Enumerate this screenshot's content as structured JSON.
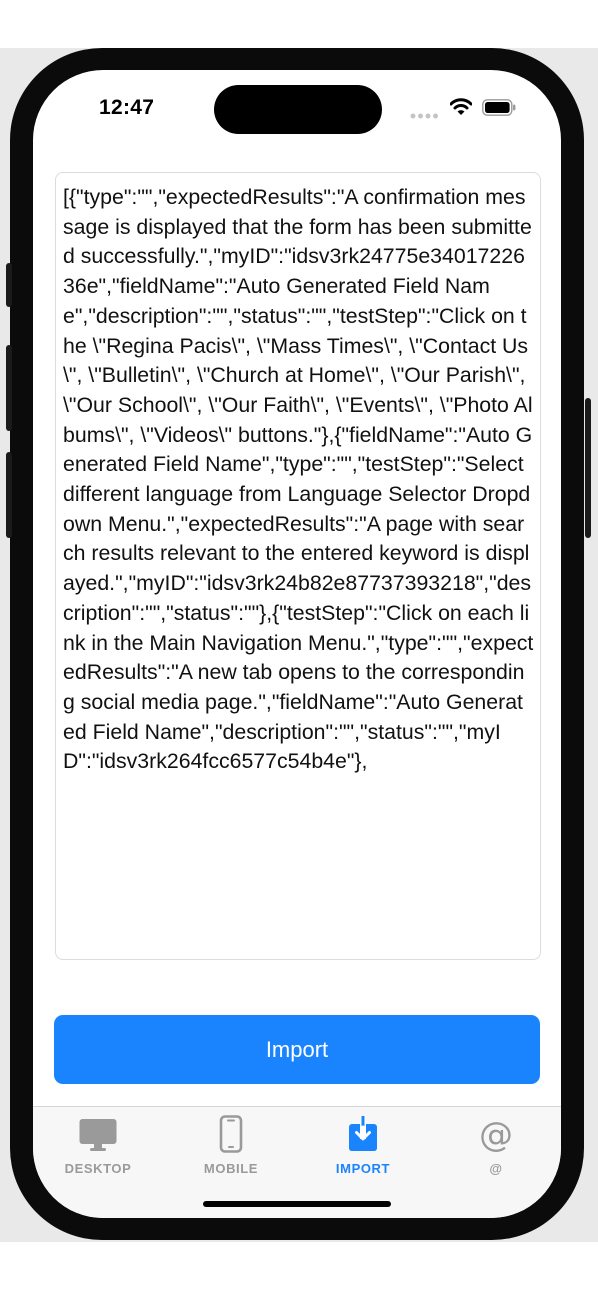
{
  "status_bar": {
    "time": "12:47"
  },
  "json_field": {
    "value": "[{\"type\":\"\",\"expectedResults\":\"A confirmation message is displayed that the form has been submitted successfully.\",\"myID\":\"idsv3rk24775e3401722636e\",\"fieldName\":\"Auto Generated Field Name\",\"description\":\"\",\"status\":\"\",\"testStep\":\"Click on the \\\"Regina Pacis\\\", \\\"Mass Times\\\", \\\"Contact Us\\\", \\\"Bulletin\\\", \\\"Church at Home\\\", \\\"Our Parish\\\", \\\"Our School\\\", \\\"Our Faith\\\", \\\"Events\\\", \\\"Photo Albums\\\", \\\"Videos\\\" buttons.\"},{\"fieldName\":\"Auto Generated Field Name\",\"type\":\"\",\"testStep\":\"Select different language from Language Selector Dropdown Menu.\",\"expectedResults\":\"A page with search results relevant to the entered keyword is displayed.\",\"myID\":\"idsv3rk24b82e87737393218\",\"description\":\"\",\"status\":\"\"},{\"testStep\":\"Click on each link in the Main Navigation Menu.\",\"type\":\"\",\"expectedResults\":\"A new tab opens to the corresponding social media page.\",\"fieldName\":\"Auto Generated Field Name\",\"description\":\"\",\"status\":\"\",\"myID\":\"idsv3rk264fcc6577c54b4e\"},"
  },
  "import_button": {
    "label": "Import"
  },
  "tabs": [
    {
      "label": "DESKTOP",
      "icon": "desktop-icon",
      "active": false
    },
    {
      "label": "MOBILE",
      "icon": "mobile-icon",
      "active": false
    },
    {
      "label": "IMPORT",
      "icon": "import-icon",
      "active": true
    },
    {
      "label": "@",
      "icon": "at-icon",
      "active": false
    }
  ],
  "colors": {
    "accent": "#1a84ff",
    "inactive": "#9a9a9a"
  }
}
